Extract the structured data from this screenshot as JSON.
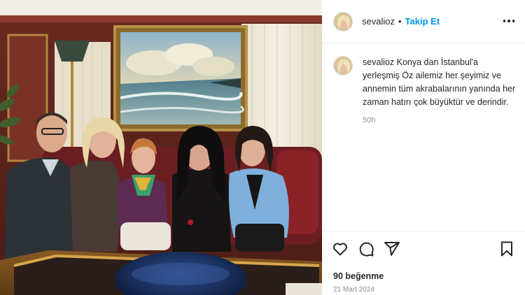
{
  "post": {
    "username": "sevalioz",
    "separator": "•",
    "follow_label": "Takip Et",
    "caption_user": "sevalioz",
    "caption_text": " Konya dan İstanbul'a yerleşmiş Öz ailemiz her şeyimiz ve annemin tüm akrabalarının yanında her zaman hatırı çok büyüktür ve derindir.",
    "time_ago": "50h",
    "likes": "90 beğenme",
    "date": "21 Mart 2024"
  },
  "icons": {
    "more": "more-options-icon",
    "like": "heart-icon",
    "comment": "comment-icon",
    "share": "share-icon",
    "save": "bookmark-icon"
  },
  "colors": {
    "follow": "#0095f6",
    "text": "#262626",
    "muted": "#8e8e8e",
    "divider": "#efefef"
  }
}
